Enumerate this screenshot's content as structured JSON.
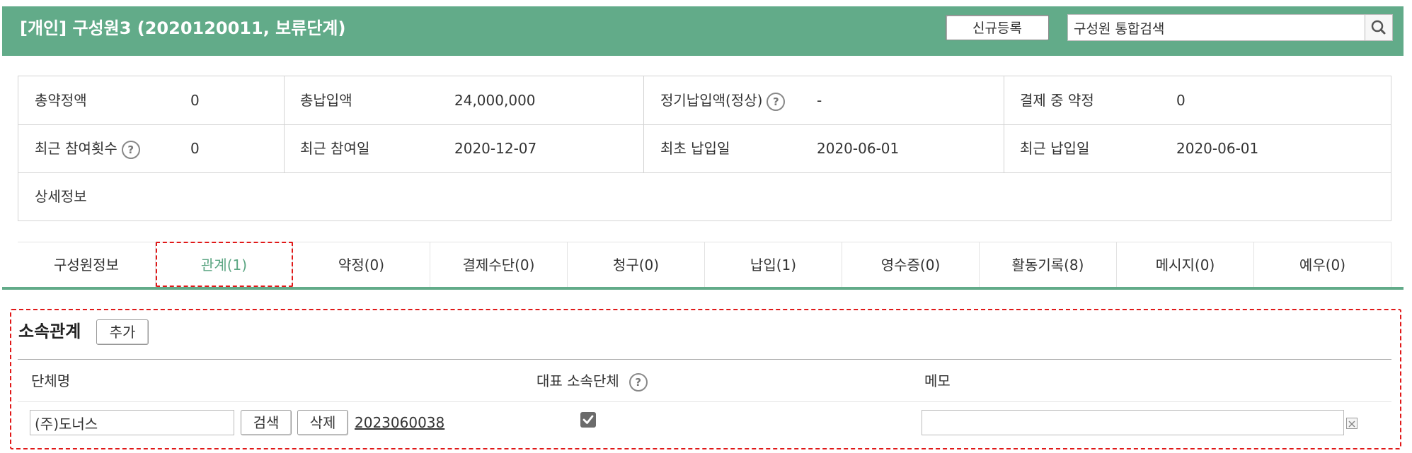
{
  "header": {
    "title": "[개인] 구성원3 (2020120011, 보류단계)",
    "new_button": "신규등록",
    "search_placeholder": "구성원 통합검색",
    "search_icon": "search-icon",
    "bg_color": "#62ab89"
  },
  "summary": {
    "row1": [
      {
        "label": "총약정액",
        "value": "0"
      },
      {
        "label": "총납입액",
        "value": "24,000,000"
      },
      {
        "label": "정기납입액(정상)",
        "value": "-",
        "help": "?"
      },
      {
        "label": "결제 중 약정",
        "value": "0"
      }
    ],
    "row2": [
      {
        "label": "최근 참여횟수",
        "value": "0",
        "help": "?"
      },
      {
        "label": "최근 참여일",
        "value": "2020-12-07"
      },
      {
        "label": "최초 납입일",
        "value": "2020-06-01"
      },
      {
        "label": "최근 납입일",
        "value": "2020-06-01"
      }
    ],
    "row3_label": "상세정보"
  },
  "tabs": [
    {
      "label": "구성원정보",
      "active": false
    },
    {
      "label": "관계(1)",
      "active": true
    },
    {
      "label": "약정(0)",
      "active": false
    },
    {
      "label": "결제수단(0)",
      "active": false
    },
    {
      "label": "청구(0)",
      "active": false
    },
    {
      "label": "납입(1)",
      "active": false
    },
    {
      "label": "영수증(0)",
      "active": false
    },
    {
      "label": "활동기록(8)",
      "active": false
    },
    {
      "label": "메시지(0)",
      "active": false
    },
    {
      "label": "예우(0)",
      "active": false
    }
  ],
  "affiliation": {
    "title": "소속관계",
    "add_button": "추가",
    "columns": {
      "org_name": "단체명",
      "primary": "대표 소속단체",
      "memo": "메모"
    },
    "help": "?",
    "row": {
      "org_name": "(주)도너스",
      "search_button": "검색",
      "delete_button": "삭제",
      "org_id": "2023060038",
      "primary_checked": true,
      "memo": ""
    }
  }
}
